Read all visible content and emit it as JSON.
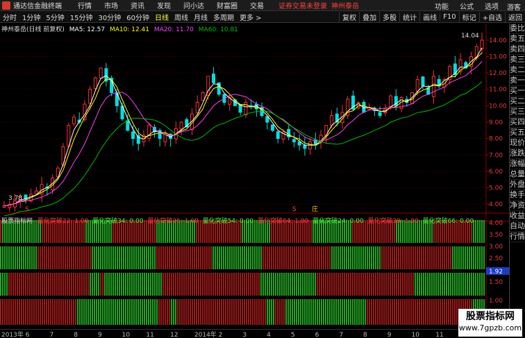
{
  "app": {
    "title": "通达信金融终端",
    "menu": [
      "行情",
      "市场",
      "资讯",
      "发现",
      "问小达",
      "财富圈",
      "交易"
    ],
    "warning": "证券交易未登录",
    "stock_top": "神州泰岳",
    "right_menu": [
      "功能",
      "公式",
      "选项"
    ],
    "guest": "游客"
  },
  "toolbar": {
    "periods": [
      "分时",
      "1分钟",
      "5分钟",
      "15分钟",
      "30分钟",
      "60分钟",
      "日线",
      "周线",
      "月线",
      "多周期",
      "更多 >"
    ],
    "active_period": "日线",
    "right_buttons": [
      "复权",
      "叠加",
      "多股",
      "统计",
      "画线",
      "F10",
      "标记",
      "+自选",
      "返回"
    ]
  },
  "stock": {
    "name": "神州泰岳(日线 前复权)",
    "ma5": "MA5: 12.57",
    "ma10": "MA10: 12.41",
    "ma20": "MA20: 11.70",
    "ma60": "MA60: 10.81",
    "high_label": "14.04",
    "low_label": "3.78",
    "markers": [
      "S",
      "S",
      "庄"
    ]
  },
  "indicator": {
    "name": "股票指标网",
    "params": [
      {
        "label": "量化突破22: 1.00",
        "color": "#ff4040"
      },
      {
        "label": "量化突破34: 0.00",
        "color": "#40ff40"
      },
      {
        "label": "量化突破26: 1.00",
        "color": "#ff4040"
      },
      {
        "label": "量化突破54: 0.00",
        "color": "#40ff40"
      },
      {
        "label": "量化突破64: 1.00",
        "color": "#ff4040"
      },
      {
        "label": "量化突破24: 0.00",
        "color": "#40ff40"
      },
      {
        "label": "量化突破39: 1.00",
        "color": "#ff4040"
      },
      {
        "label": "量化突破66: 0.00",
        "color": "#40ff40"
      }
    ],
    "current_value": "1.92"
  },
  "price_axis": [
    "14.00",
    "13.00",
    "12.00",
    "11.00",
    "10.00",
    "9.00",
    "8.00",
    "7.00",
    "6.00",
    "5.00",
    "4.00"
  ],
  "ind_axis": [
    "4.00",
    "3.50",
    "3.00",
    "2.50",
    "2.00",
    "1.50",
    "1.00"
  ],
  "time_axis": [
    "2013年",
    "6",
    "7",
    "8",
    "9",
    "10",
    "11",
    "12",
    "2014年",
    "2",
    "3",
    "4",
    "5",
    "6",
    "7",
    "8",
    "9",
    "10",
    "11",
    "12"
  ],
  "right_panel": [
    "委比",
    "卖五",
    "卖四",
    "卖三",
    "卖二",
    "卖一",
    "买一",
    "买二",
    "买三",
    "买四",
    "买五",
    "现价",
    "涨跌",
    "涨幅",
    "总量",
    "外盘",
    "换手",
    "净资",
    "收益",
    "自动",
    "行情"
  ],
  "watermark": {
    "title": "股票指标网",
    "url": "www.7gpzb.com"
  },
  "chart_data": {
    "type": "line",
    "title": "神州泰岳(日线 前复权)",
    "ylim": [
      3.5,
      14.5
    ],
    "series": [
      {
        "name": "MA5",
        "color": "#ffffff"
      },
      {
        "name": "MA10",
        "color": "#ffff00"
      },
      {
        "name": "MA20",
        "color": "#ff40ff"
      },
      {
        "name": "MA60",
        "color": "#00c000"
      }
    ],
    "close": [
      3.9,
      4.0,
      4.2,
      4.5,
      4.3,
      4.6,
      4.8,
      5.2,
      5.0,
      5.6,
      6.2,
      7.5,
      8.8,
      9.3,
      9.0,
      10.1,
      11.0,
      11.7,
      12.3,
      11.5,
      10.8,
      10.0,
      9.2,
      8.5,
      8.0,
      7.7,
      8.2,
      8.8,
      8.4,
      8.0,
      8.3,
      8.0,
      8.6,
      9.0,
      8.7,
      9.5,
      10.2,
      10.8,
      11.8,
      11.4,
      10.7,
      10.2,
      10.5,
      10.0,
      9.6,
      10.2,
      10.0,
      9.8,
      9.4,
      9.0,
      8.5,
      8.0,
      8.4,
      8.1,
      7.8,
      7.6,
      7.4,
      7.8,
      7.6,
      8.2,
      8.8,
      9.4,
      9.0,
      9.6,
      10.4,
      9.8,
      10.2,
      9.6,
      9.9,
      9.7,
      9.4,
      9.8,
      10.6,
      10.0,
      10.5,
      10.2,
      10.8,
      11.6,
      11.2,
      10.7,
      11.8,
      11.2,
      11.6,
      12.4,
      11.9,
      12.8,
      12.3,
      13.0,
      13.6,
      14.0
    ]
  }
}
